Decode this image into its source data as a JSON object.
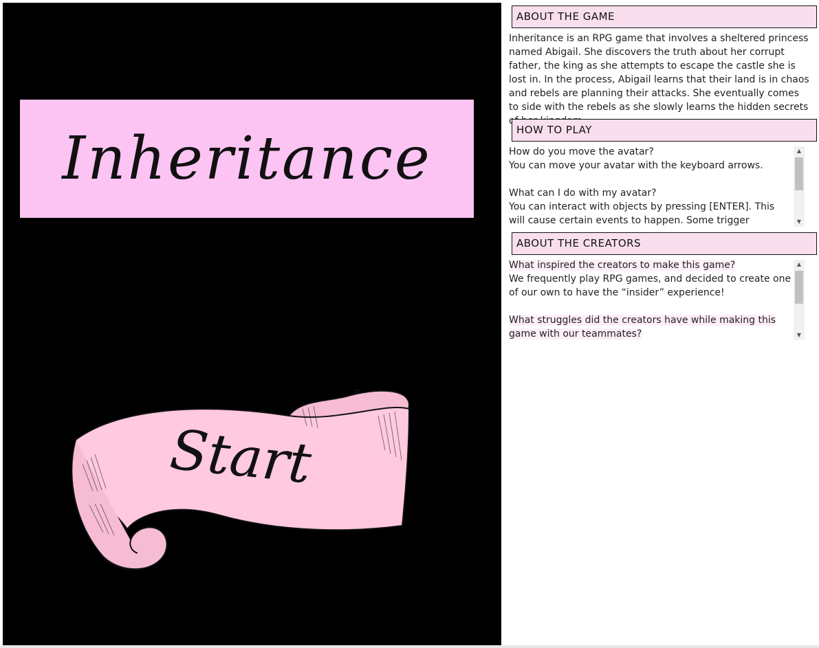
{
  "game": {
    "title": "Inheritance",
    "start_label": "Start"
  },
  "about_game": {
    "header": "ABOUT THE GAME",
    "text": "Inheritance is an RPG game that involves a sheltered princess named Abigail. She discovers the truth about her corrupt father, the king as she attempts to escape the castle she is lost in. In the process, Abigail learns that their land is in chaos and rebels are planning their attacks. She eventually comes to side with the rebels as she slowly learns the hidden secrets of her kingdom."
  },
  "how_to_play": {
    "header": "HOW TO PLAY",
    "q1": "How do you move the avatar?",
    "a1": "You can move your avatar with the keyboard arrows.",
    "q2": "What can I do with my avatar?",
    "a2": "You can interact with objects by pressing [ENTER]. This will cause certain events to happen. Some trigger dialogue events,"
  },
  "about_creators": {
    "header": "ABOUT THE CREATORS",
    "q1": "What inspired the creators to make this game?",
    "a1": "We frequently play RPG games, and decided to create one of our own to have the “insider” experience!",
    "q2": "What struggles did the creators have while making this game with our teammates?"
  },
  "colors": {
    "canvas_bg": "#000000",
    "title_bg": "#fcc4f2",
    "banner_pink": "#ffc9df",
    "header_bg": "#f9dfee"
  }
}
